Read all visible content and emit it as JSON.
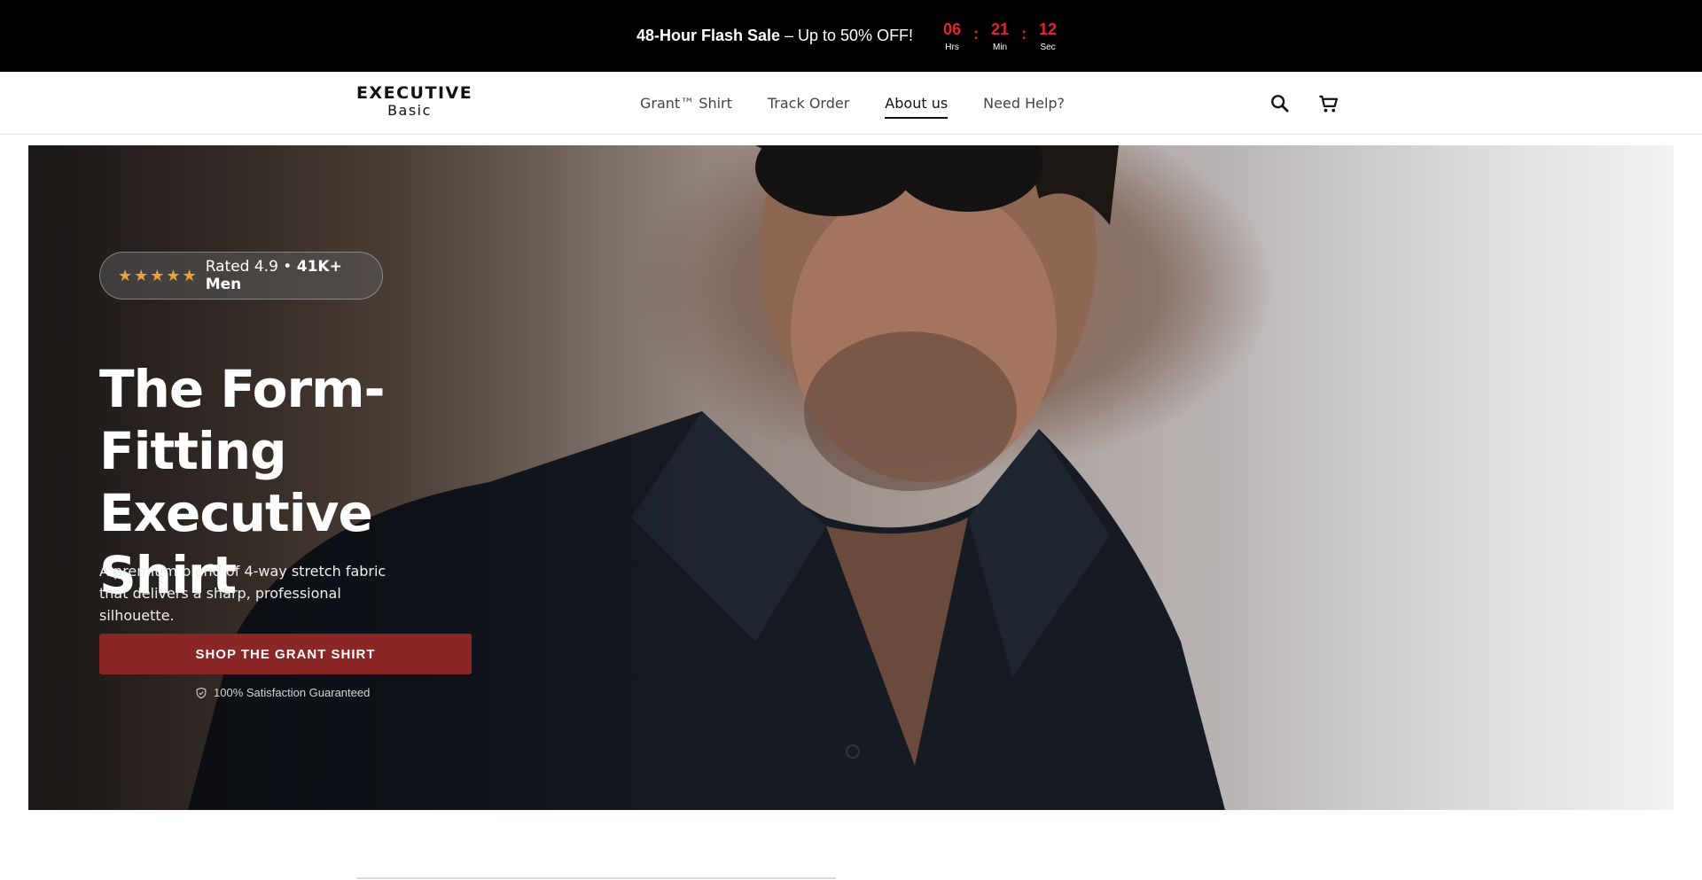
{
  "announcement": {
    "bold": "48-Hour Flash Sale",
    "rest": " – Up to 50% OFF!",
    "countdown": {
      "hours": "06",
      "hours_label": "Hrs",
      "minutes": "21",
      "minutes_label": "Min",
      "seconds": "12",
      "seconds_label": "Sec",
      "separator": ":"
    },
    "accent_color": "#e0232e"
  },
  "header": {
    "logo_top": "EXECUTIVE",
    "logo_bottom": "Basic",
    "nav": [
      {
        "label": "Grant™ Shirt",
        "active": false
      },
      {
        "label": "Track Order",
        "active": false
      },
      {
        "label": "About us",
        "active": true
      },
      {
        "label": "Need Help?",
        "active": false
      }
    ],
    "icons": [
      "search-icon",
      "cart-icon"
    ]
  },
  "hero": {
    "stars": "★★★★★",
    "rating_prefix": "Rated 4.9 • ",
    "rating_bold": "41K+ Men",
    "title": "The Form-Fitting Executive Shirt",
    "subtitle": "A premium blend of 4-way stretch fabric that delivers a sharp, professional silhouette.",
    "cta_label": "SHOP THE GRANT SHIRT",
    "guarantee": "100% Satisfaction Guaranteed",
    "cta_color": "#8b2626",
    "star_color": "#e6a33c"
  }
}
